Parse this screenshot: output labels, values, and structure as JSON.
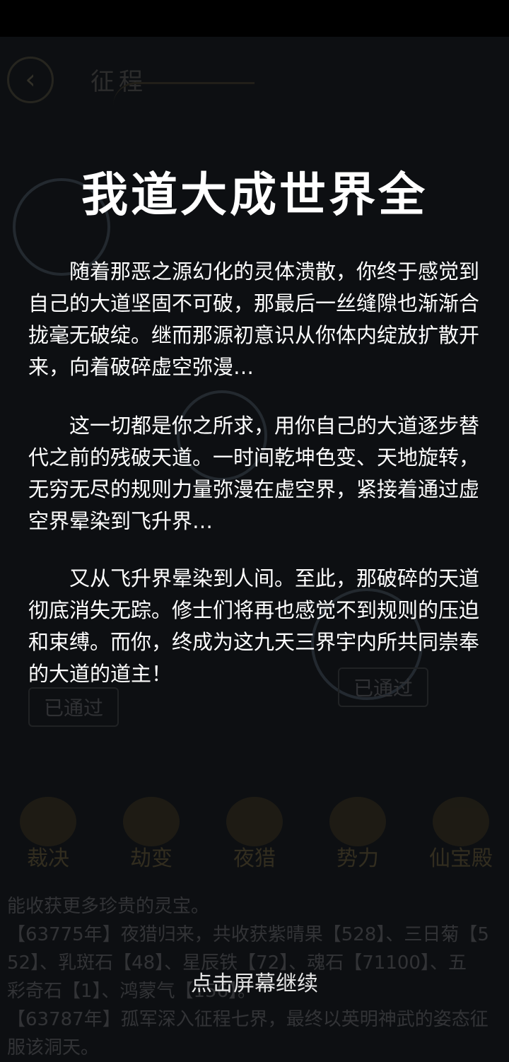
{
  "background": {
    "screen_title": "征程",
    "passed_badges": [
      "已通过",
      "已通过"
    ],
    "bottom_nav": [
      {
        "label": "裁决",
        "icon": "banner-icon"
      },
      {
        "label": "劫变",
        "icon": "flame-emblem-icon"
      },
      {
        "label": "夜猎",
        "icon": "wing-emblem-icon"
      },
      {
        "label": "势力",
        "icon": "phoenix-emblem-icon"
      },
      {
        "label": "仙宝殿",
        "icon": "treasure-emblem-icon"
      }
    ],
    "log_lines": [
      "能收获更多珍贵的灵宝。",
      "【63775年】夜猎归来，共收获紫晴果【528】、三日菊【5",
      "52】、乳斑石【48】、星辰铁【72】、魂石【71100】、五",
      "彩奇石【1】、鸿蒙气【156】。",
      "【63787年】孤军深入征程七界，最终以英明神武的姿态征",
      "服该洞天。"
    ]
  },
  "story": {
    "title": "我道大成世界全",
    "paragraphs": [
      "随着那恶之源幻化的灵体溃散，你终于感觉到自己的大道坚固不可破，那最后一丝缝隙也渐渐合拢毫无破绽。继而那源初意识从你体内绽放扩散开来，向着破碎虚空弥漫…",
      "这一切都是你之所求，用你自己的大道逐步替代之前的残破天道。一时间乾坤色变、天地旋转，无穷无尽的规则力量弥漫在虚空界，紧接着通过虚空界晕染到飞升界…",
      "又从飞升界晕染到人间。至此，那破碎的天道彻底消失无踪。修士们将再也感觉不到规则的压迫和束缚。而你，终成为这九天三界宇内所共同崇奉的大道的道主！"
    ],
    "continue_hint": "点击屏幕继续"
  }
}
